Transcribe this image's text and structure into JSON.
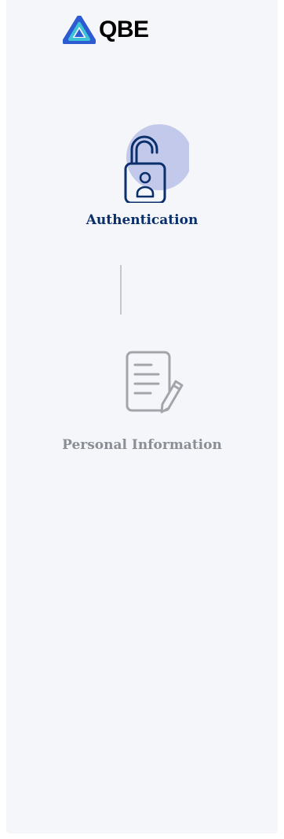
{
  "brand": {
    "name": "QBE",
    "logo_icon": "qbe-logo-icon",
    "color_primary": "#2d5bd1",
    "color_accent": "#3ec3d6"
  },
  "steps": [
    {
      "label": "Authentication",
      "icon": "unlocked-padlock-user-icon",
      "state": "active",
      "color": "#0a2f6b",
      "highlight_color": "#c3c9ea"
    },
    {
      "label": "Personal Information",
      "icon": "document-edit-icon",
      "state": "inactive",
      "color": "#8a8f96"
    }
  ]
}
